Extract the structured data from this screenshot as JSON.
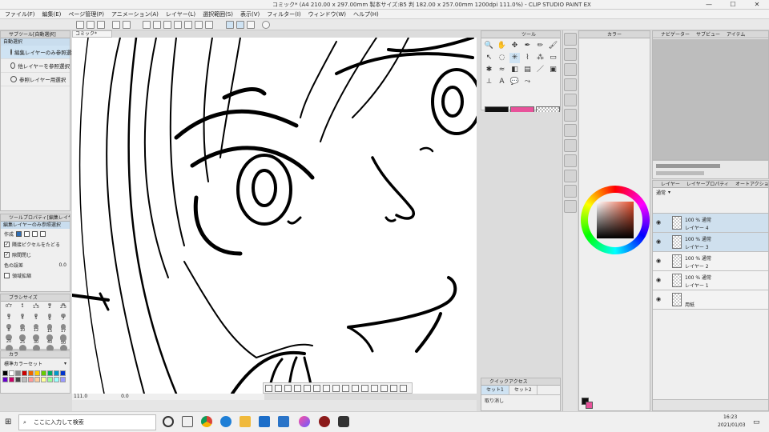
{
  "window": {
    "title": "コミック* (A4 210.00 x 297.00mm 製本サイズ:B5 判 182.00 x 257.00mm 1200dpi 111.0%) - CLIP STUDIO PAINT EX",
    "minimize": "—",
    "maximize": "☐",
    "close": "✕"
  },
  "menu": [
    "ファイル(F)",
    "編集(E)",
    "ページ管理(P)",
    "アニメーション(A)",
    "レイヤー(L)",
    "選択範囲(S)",
    "表示(V)",
    "フィルター(I)",
    "ウィンドウ(W)",
    "ヘルプ(H)"
  ],
  "canvas_tab": "コミック*",
  "subtool": {
    "header": "サブツール[自動選択]",
    "group": "自動選択",
    "items": [
      "編集レイヤーのみ参照選択",
      "他レイヤーを参照選択",
      "参照レイヤー用選択"
    ]
  },
  "tool_property": {
    "header": "ツールプロパティ[編集レイヤーの...]",
    "name": "編集レイヤーのみ参照選択",
    "mode_label": "作成",
    "follow_adjacent": "隣接ピクセルをたどる",
    "close_gap": "隙間閉じ",
    "color_tolerance_label": "色の誤差",
    "color_tolerance_value": "0.0",
    "expand_area": "領域拡縮"
  },
  "brush_size": {
    "header": "ブラシサイズ",
    "sizes": [
      "0.7",
      "1",
      "1.5",
      "2",
      "2.5",
      "3",
      "4",
      "5",
      "6",
      "7",
      "8",
      "10",
      "12",
      "15",
      "17",
      "20",
      "25",
      "30",
      "40",
      "50",
      "60",
      "70",
      "80",
      "100",
      "120"
    ]
  },
  "color_set": {
    "tab": "カラ",
    "name": "標準カラーセット"
  },
  "zoom": {
    "value": "111.0",
    "angle": "0.0"
  },
  "tool_panel": {
    "tab": "ツール"
  },
  "colors": {
    "main": "#111111",
    "sub": "#e8529a",
    "accent": "#2e6db4",
    "selection_bg": "#cfe3f3"
  },
  "quick_access": {
    "header": "クイックアクセス",
    "tabs": [
      "セット1",
      "セット2"
    ],
    "item": "取り消し"
  },
  "color_wheel": {
    "tab": "カラー"
  },
  "navigator": {
    "tabs": [
      "ナビゲーター",
      "サブビュー",
      "アイテム"
    ]
  },
  "layer_panel": {
    "tabs": [
      "レイヤー",
      "レイヤープロパティ",
      "オートアクション"
    ],
    "blend": "通常",
    "layers": [
      {
        "mode": "100 % 通常",
        "name": "レイヤー 4",
        "selected": true
      },
      {
        "mode": "100 % 通常",
        "name": "レイヤー 3",
        "selected": true
      },
      {
        "mode": "100 % 通常",
        "name": "レイヤー 2",
        "selected": false
      },
      {
        "mode": "100 % 通常",
        "name": "レイヤー 1",
        "selected": false
      },
      {
        "mode": "",
        "name": "用紙",
        "selected": false
      }
    ]
  },
  "taskbar": {
    "search_placeholder": "ここに入力して検索",
    "time": "16:23",
    "date": "2021/01/03"
  }
}
